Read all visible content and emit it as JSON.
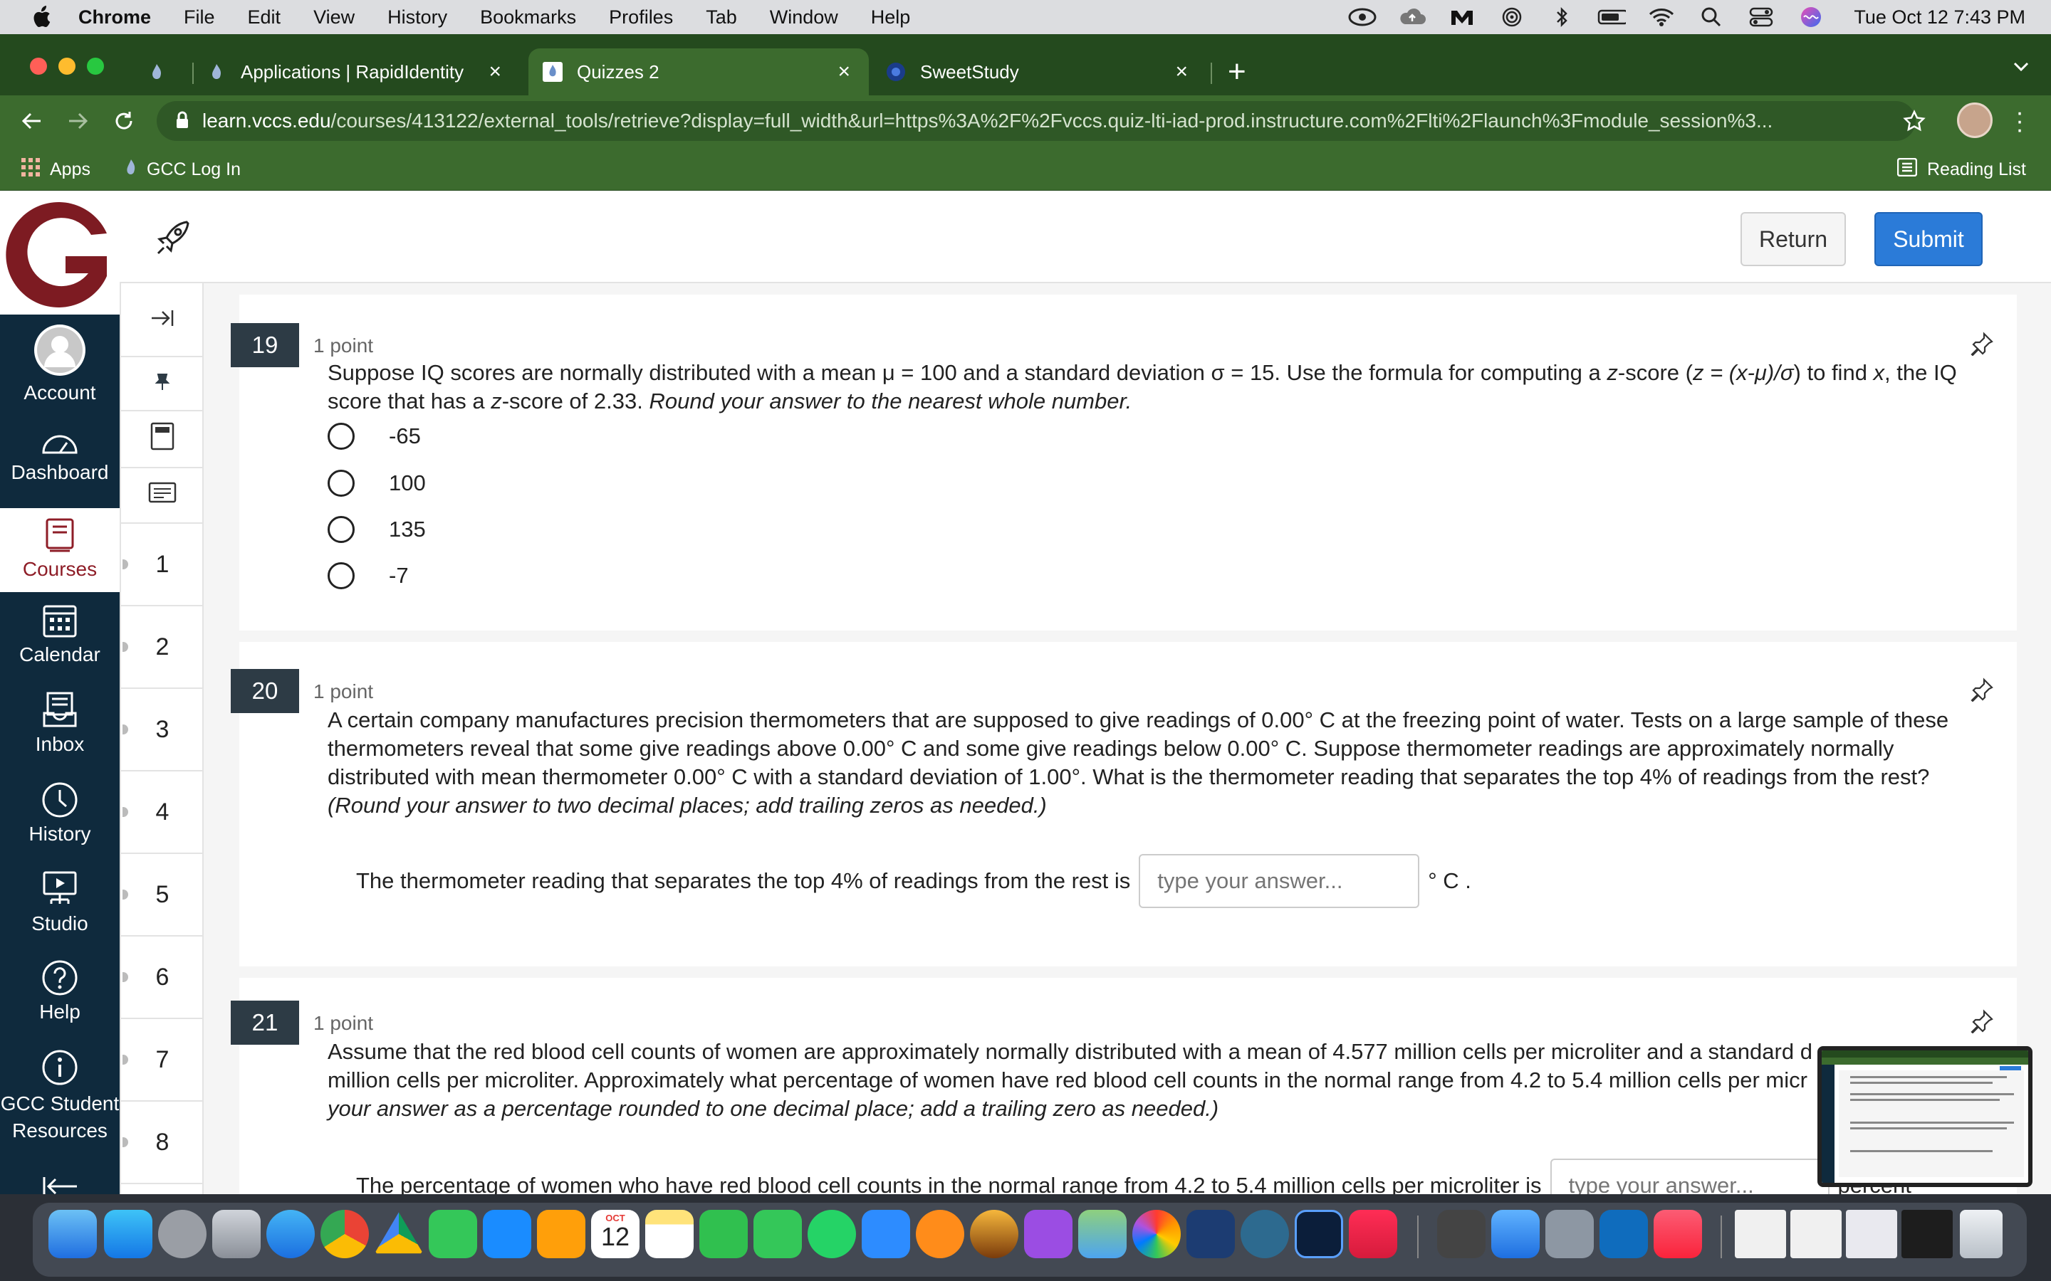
{
  "menubar": {
    "app": "Chrome",
    "items": [
      "File",
      "Edit",
      "View",
      "History",
      "Bookmarks",
      "Profiles",
      "Tab",
      "Window",
      "Help"
    ],
    "clock": "Tue Oct 12  7:43 PM"
  },
  "browser": {
    "tabs": [
      {
        "title": "Applications | RapidIdentity"
      },
      {
        "title": "Quizzes 2"
      },
      {
        "title": "SweetStudy"
      }
    ],
    "url_domain": "learn.vccs.edu",
    "url_path": "/courses/413122/external_tools/retrieve?display=full_width&url=https%3A%2F%2Fvccs.quiz-lti-iad-prod.instructure.com%2Flti%2Flaunch%3Fmodule_session%3...",
    "bookmarks": {
      "apps": "Apps",
      "gcc": "GCC Log In",
      "reading": "Reading List"
    }
  },
  "header": {
    "return_label": "Return",
    "submit_label": "Submit"
  },
  "global_nav": [
    {
      "label": "Account",
      "icon": "account-icon"
    },
    {
      "label": "Dashboard",
      "icon": "dashboard-icon"
    },
    {
      "label": "Courses",
      "icon": "courses-icon"
    },
    {
      "label": "Calendar",
      "icon": "calendar-icon"
    },
    {
      "label": "Inbox",
      "icon": "inbox-icon"
    },
    {
      "label": "History",
      "icon": "history-icon"
    },
    {
      "label": "Studio",
      "icon": "studio-icon"
    },
    {
      "label": "Help",
      "icon": "help-icon"
    },
    {
      "label": "GCC Student Resources",
      "icon": "info-icon"
    }
  ],
  "question_nav": [
    "1",
    "2",
    "3",
    "4",
    "5",
    "6",
    "7",
    "8"
  ],
  "questions": [
    {
      "number": "19",
      "points": "1 point",
      "text_a": "Suppose IQ scores are normally distributed with a mean μ = 100 and a standard deviation σ = 15. Use the formula for computing a ",
      "text_b": "z",
      "text_c": "-score (",
      "text_d": "z = (x-μ)/σ",
      "text_e": ") to find ",
      "text_f": "x",
      "text_g": ", the IQ score that has a ",
      "text_h": "z",
      "text_i": "-score of 2.33. ",
      "text_j": "Round your answer to the nearest whole number.",
      "options": [
        "-65",
        "100",
        "135",
        "-7"
      ]
    },
    {
      "number": "20",
      "points": "1 point",
      "text": "A certain company manufactures precision thermometers that are supposed to give readings of 0.00° C at the freezing point of water. Tests on a large sample of these thermometers reveal that some give readings above 0.00° C and some give readings below 0.00° C. Suppose thermometer readings are approximately normally distributed with mean thermometer 0.00° C with a standard deviation of 1.00°. What is the thermometer reading that separates the top 4% of readings from the rest? ",
      "text_italic": "(Round your answer to two decimal places; add trailing zeros as needed.)",
      "fill_prefix": "The thermometer reading that separates the top 4% of readings from the rest is",
      "fill_placeholder": "type your answer...",
      "fill_suffix": "° C ."
    },
    {
      "number": "21",
      "points": "1 point",
      "text": "Assume that the red blood cell counts of women are approximately normally distributed with a mean of 4.577 million cells per microliter and a standard d",
      "text2": "million cells per microliter. Approximately what percentage of women have red blood cell counts in the normal range from 4.2 to 5.4 million cells per micr",
      "text_italic": "your answer as a percentage rounded to one decimal place; add a trailing zero as needed.)",
      "fill_prefix": "The percentage of women who have red blood cell counts in the normal range from 4.2 to 5.4 million cells per microliter is",
      "fill_placeholder": "type your answer...",
      "fill_suffix": "percent"
    }
  ],
  "dock": {
    "calendar_month": "OCT",
    "calendar_day": "12"
  }
}
